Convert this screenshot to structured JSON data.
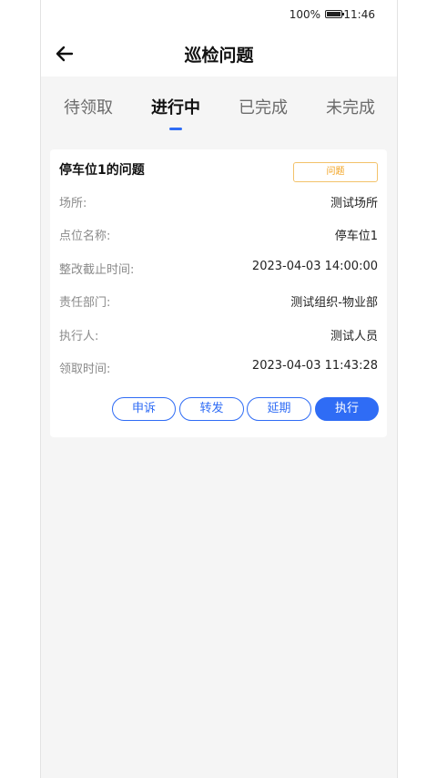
{
  "status_bar": {
    "battery": "100%",
    "time": "11:46"
  },
  "nav": {
    "title": "巡检问题",
    "back_icon": "arrow-left-icon"
  },
  "tabs": [
    {
      "label": "待领取"
    },
    {
      "label": "进行中",
      "active": true
    },
    {
      "label": "已完成"
    },
    {
      "label": "未完成"
    }
  ],
  "card": {
    "title": "停车位1的问题",
    "tag": "问题",
    "fields": [
      {
        "label": "场所:",
        "value": "测试场所"
      },
      {
        "label": "点位名称:",
        "value": "停车位1"
      },
      {
        "label": "整改截止时间:",
        "value": "2023-04-03 14:00:00"
      },
      {
        "label": "责任部门:",
        "value": "测试组织-物业部"
      },
      {
        "label": "执行人:",
        "value": "测试人员"
      },
      {
        "label": "领取时间:",
        "value": "2023-04-03 11:43:28"
      }
    ],
    "actions": [
      {
        "label": "申诉"
      },
      {
        "label": "转发"
      },
      {
        "label": "延期"
      },
      {
        "label": "执行"
      }
    ]
  },
  "colors": {
    "accent": "#2f6cf5",
    "tag": "#f2a01a",
    "background": "#f5f5f5"
  }
}
